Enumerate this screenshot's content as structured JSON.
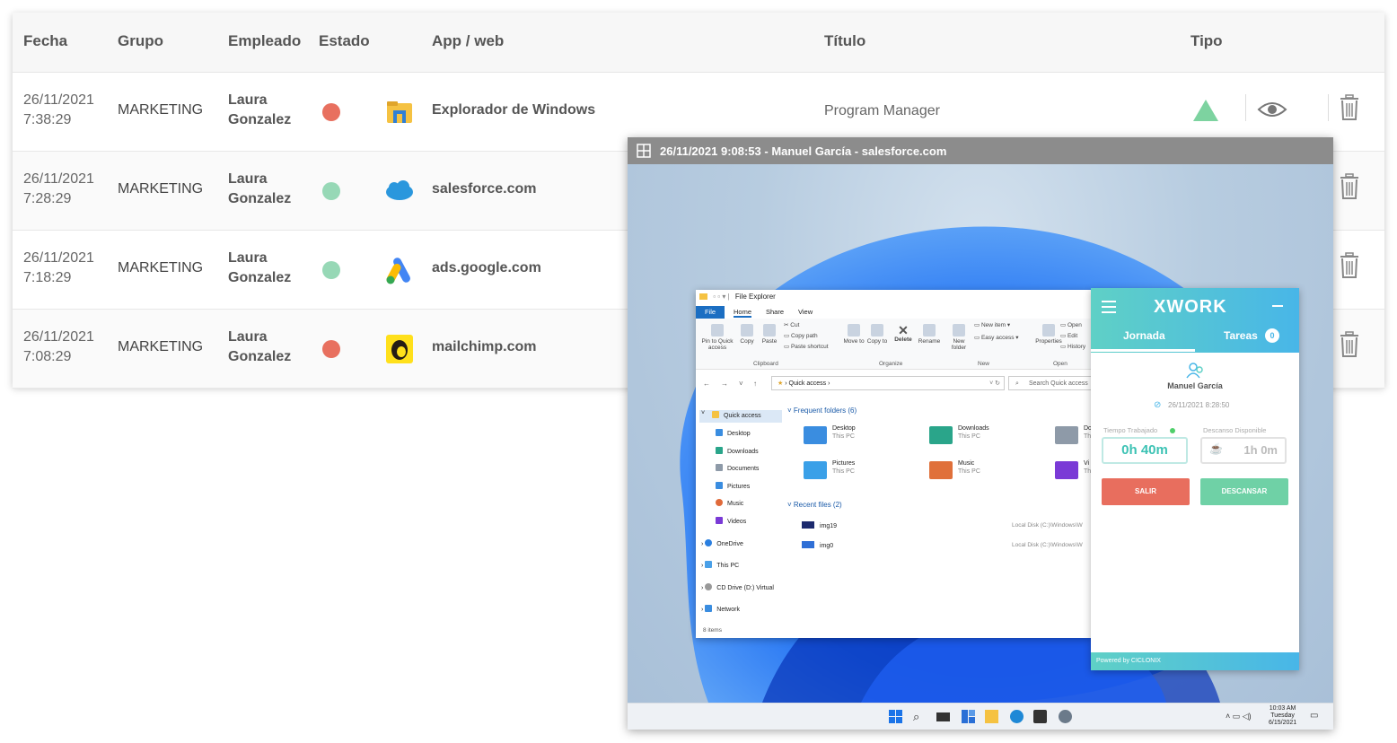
{
  "table": {
    "headers": {
      "fecha": "Fecha",
      "grupo": "Grupo",
      "empleado": "Empleado",
      "estado": "Estado",
      "app": "App / web",
      "titulo": "Título",
      "tipo": "Tipo"
    },
    "rows": [
      {
        "date": "26/11/2021",
        "time": "7:38:29",
        "group": "MARKETING",
        "emp_first": "Laura",
        "emp_last": "Gonzalez",
        "status_color": "#e8705f",
        "app_icon": "windows-explorer-icon",
        "app": "Explorador de Windows",
        "title": "Program Manager"
      },
      {
        "date": "26/11/2021",
        "time": "7:28:29",
        "group": "MARKETING",
        "emp_first": "Laura",
        "emp_last": "Gonzalez",
        "status_color": "#97d8b6",
        "app_icon": "salesforce-icon",
        "app": "salesforce.com",
        "title": ""
      },
      {
        "date": "26/11/2021",
        "time": "7:18:29",
        "group": "MARKETING",
        "emp_first": "Laura",
        "emp_last": "Gonzalez",
        "status_color": "#97d8b6",
        "app_icon": "google-ads-icon",
        "app": "ads.google.com",
        "title": ""
      },
      {
        "date": "26/11/2021",
        "time": "7:08:29",
        "group": "MARKETING",
        "emp_first": "Laura",
        "emp_last": "Gonzalez",
        "status_color": "#e8705f",
        "app_icon": "mailchimp-icon",
        "app": "mailchimp.com",
        "title": ""
      }
    ],
    "tipo_color": "#7dd3a0"
  },
  "screenshot_window": {
    "title": "26/11/2021 9:08:53 - Manuel García - salesforce.com"
  },
  "explorer": {
    "title": "File Explorer",
    "tabs": [
      "File",
      "Home",
      "Share",
      "View"
    ],
    "ribbon": {
      "pin": "Pin to Quick access",
      "copy": "Copy",
      "paste": "Paste",
      "cut": "Cut",
      "copy_path": "Copy path",
      "paste_shortcut": "Paste shortcut",
      "move_to": "Move to",
      "copy_to": "Copy to",
      "delete": "Delete",
      "rename": "Rename",
      "new_folder": "New folder",
      "new_item": "New item",
      "easy_access": "Easy access",
      "properties": "Properties",
      "open": "Open",
      "edit": "Edit",
      "history": "History",
      "groups": [
        "Clipboard",
        "Organize",
        "New",
        "Open"
      ]
    },
    "address": "Quick access",
    "search_placeholder": "Search Quick access",
    "sidebar": [
      "Quick access",
      "Desktop",
      "Downloads",
      "Documents",
      "Pictures",
      "Music",
      "Videos",
      "OneDrive",
      "This PC",
      "CD Drive (D:) Virtual",
      "Network"
    ],
    "frequent_header": "Frequent folders (6)",
    "folders": [
      {
        "name": "Desktop",
        "sub": "This PC"
      },
      {
        "name": "Downloads",
        "sub": "This PC"
      },
      {
        "name": "Do",
        "sub": "Th"
      },
      {
        "name": "Pictures",
        "sub": "This PC"
      },
      {
        "name": "Music",
        "sub": "This PC"
      },
      {
        "name": "Vi",
        "sub": "Th"
      }
    ],
    "recent_header": "Recent files (2)",
    "recent": [
      {
        "name": "img19",
        "location": "Local Disk (C:)\\Windows\\W"
      },
      {
        "name": "img0",
        "location": "Local Disk (C:)\\Windows\\W"
      }
    ],
    "status": "8 items"
  },
  "xwork": {
    "logo": "XWORK",
    "tab_jornada": "Jornada",
    "tab_tareas": "Tareas",
    "tareas_count": "0",
    "user": "Manuel García",
    "date": "26/11/2021 8:28:50",
    "worked_label": "Tiempo Trabajado",
    "worked_value": "0h 40m",
    "break_label": "Descanso Disponible",
    "break_value": "1h 0m",
    "btn_exit": "SALIR",
    "btn_rest": "DESCANSAR",
    "footer": "Powered by CICLONIX"
  },
  "taskbar": {
    "time": "10:03 AM",
    "day": "Tuesday",
    "date": "6/15/2021"
  }
}
